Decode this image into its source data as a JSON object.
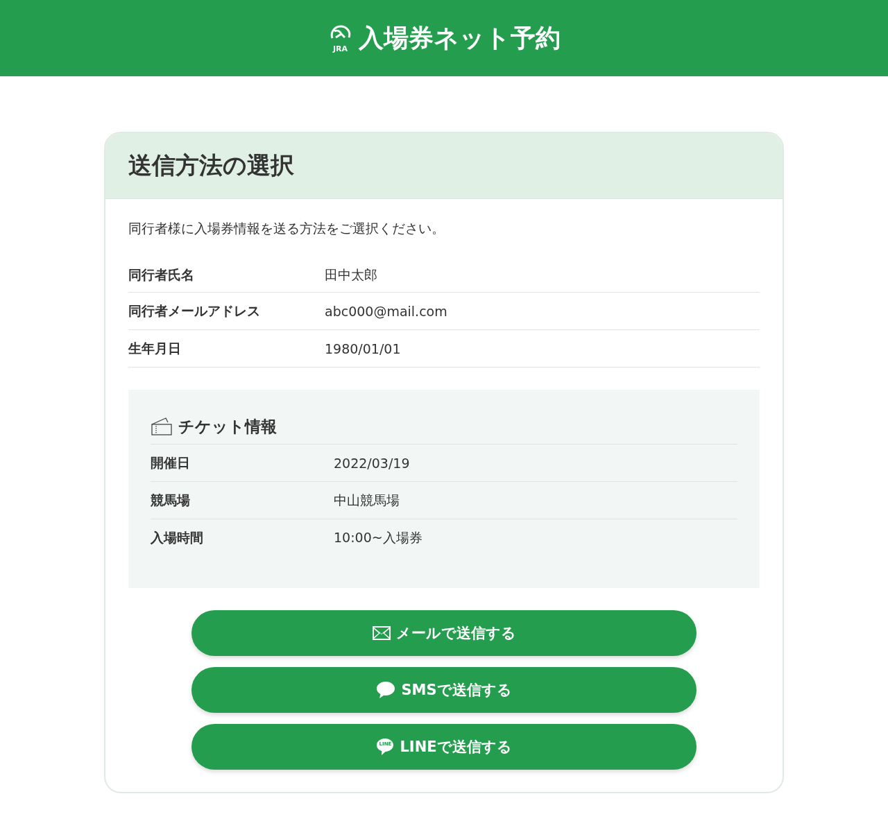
{
  "header": {
    "logo_text": "JRA",
    "title": "入場券ネット予約"
  },
  "card": {
    "title": "送信方法の選択",
    "intro": "同行者様に入場券情報を送る方法をご選択ください。",
    "companion": [
      {
        "label": "同行者氏名",
        "value": "田中太郎"
      },
      {
        "label": "同行者メールアドレス",
        "value": "abc000@mail.com"
      },
      {
        "label": "生年月日",
        "value": "1980/01/01"
      }
    ],
    "ticket": {
      "title": "チケット情報",
      "rows": [
        {
          "label": "開催日",
          "value": "2022/03/19"
        },
        {
          "label": "競馬場",
          "value": "中山競馬場"
        },
        {
          "label": "入場時間",
          "value": "10:00~入場券"
        }
      ]
    },
    "buttons": [
      {
        "kind": "mail",
        "label": "メールで送信する"
      },
      {
        "kind": "sms",
        "label": "SMSで送信する"
      },
      {
        "kind": "line",
        "label": "LINEで送信する",
        "icon_text": "LINE"
      }
    ]
  }
}
